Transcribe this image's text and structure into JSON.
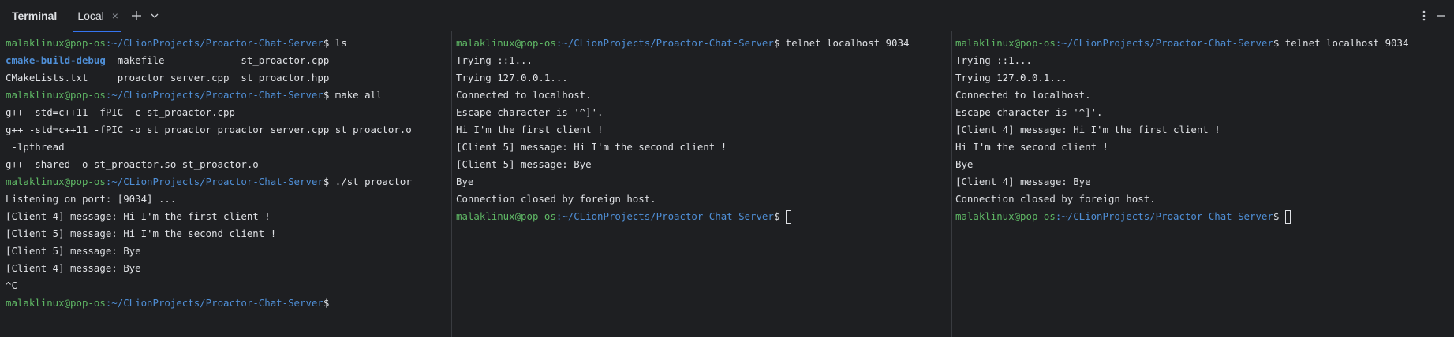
{
  "toolbar": {
    "title": "Terminal",
    "tab_label": "Local",
    "close_glyph": "×",
    "add_icon": "plus-icon",
    "dropdown_icon": "chevron-down-icon",
    "more_icon": "more-vertical-icon",
    "minimize_icon": "minimize-icon"
  },
  "colors": {
    "background": "#1e1f22",
    "user_host": "#5fb865",
    "path": "#4f8fd7",
    "text": "#dfe1e5",
    "tab_underline": "#3574f0"
  },
  "prompt": {
    "user_host": "malaklinux@pop-os",
    "path": ":~/CLionProjects/Proactor-Chat-Server",
    "dollar": "$"
  },
  "pane1": {
    "cmd_ls": " ls",
    "ls_row1_a": "cmake-build-debug",
    "ls_row1_rest": "  makefile             st_proactor.cpp",
    "ls_row2": "CMakeLists.txt     proactor_server.cpp  st_proactor.hpp",
    "cmd_make": " make all",
    "make_out1": "g++ -std=c++11 -fPIC -c st_proactor.cpp",
    "make_out2": "g++ -std=c++11 -fPIC -o st_proactor proactor_server.cpp st_proactor.o",
    "make_out3": " -lpthread",
    "make_out4": "g++ -shared -o st_proactor.so st_proactor.o",
    "cmd_run": " ./st_proactor",
    "run_out1": "Listening on port: [9034] ...",
    "run_out2": "[Client 4] message: Hi I'm the first client !",
    "run_out3": "[Client 5] message: Hi I'm the second client !",
    "run_out4": "[Client 5] message: Bye",
    "run_out5": "[Client 4] message: Bye",
    "run_out6": "^C"
  },
  "pane2": {
    "cmd": " telnet localhost 9034",
    "out1": "Trying ::1...",
    "out2": "Trying 127.0.0.1...",
    "out3": "Connected to localhost.",
    "out4": "Escape character is '^]'.",
    "out5": "Hi I'm the first client !",
    "out6": "[Client 5] message: Hi I'm the second client !",
    "out7": "[Client 5] message: Bye",
    "out8": "Bye",
    "out9": "Connection closed by foreign host."
  },
  "pane3": {
    "cmd": " telnet localhost 9034",
    "out1": "Trying ::1...",
    "out2": "Trying 127.0.0.1...",
    "out3": "Connected to localhost.",
    "out4": "Escape character is '^]'.",
    "out5": "[Client 4] message: Hi I'm the first client !",
    "out6": "Hi I'm the second client !",
    "out7": "Bye",
    "out8": "[Client 4] message: Bye",
    "out9": "Connection closed by foreign host."
  }
}
